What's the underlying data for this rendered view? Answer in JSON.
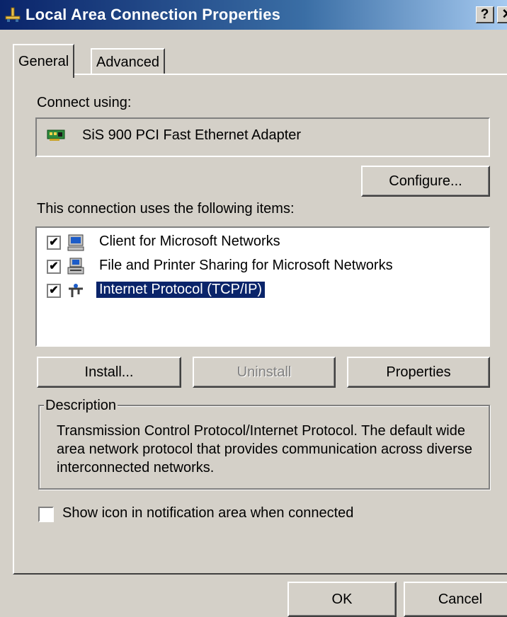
{
  "window": {
    "title": "Local Area Connection Properties",
    "help_glyph": "?",
    "close_glyph": "✕"
  },
  "tabs": [
    {
      "label": "General",
      "selected": true
    },
    {
      "label": "Advanced",
      "selected": false
    }
  ],
  "connect": {
    "label": "Connect using:",
    "adapter_name": "SiS 900 PCI Fast Ethernet Adapter",
    "adapter_icon": "network-card-icon",
    "configure_label": "Configure..."
  },
  "items": {
    "label": "This connection uses the following items:",
    "list": [
      {
        "label": "Client for Microsoft Networks",
        "checked": true,
        "icon": "computer-network-icon",
        "selected": false
      },
      {
        "label": "File and Printer Sharing for Microsoft Networks",
        "checked": true,
        "icon": "printer-sharing-icon",
        "selected": false
      },
      {
        "label": "Internet Protocol (TCP/IP)",
        "checked": true,
        "icon": "protocol-icon",
        "selected": true
      }
    ],
    "check_glyph": "✔"
  },
  "buttons": {
    "install": "Install...",
    "uninstall": "Uninstall",
    "properties": "Properties",
    "ok": "OK",
    "cancel": "Cancel"
  },
  "description": {
    "legend": "Description",
    "text": "Transmission Control Protocol/Internet Protocol. The default wide area network protocol that provides communication across diverse interconnected networks."
  },
  "notify": {
    "label": "Show icon in notification area when connected",
    "checked": false
  },
  "colors": {
    "titlebar_start": "#0a246a",
    "titlebar_end": "#a6caf0",
    "face": "#d4d0c8",
    "selection": "#0a246a"
  }
}
